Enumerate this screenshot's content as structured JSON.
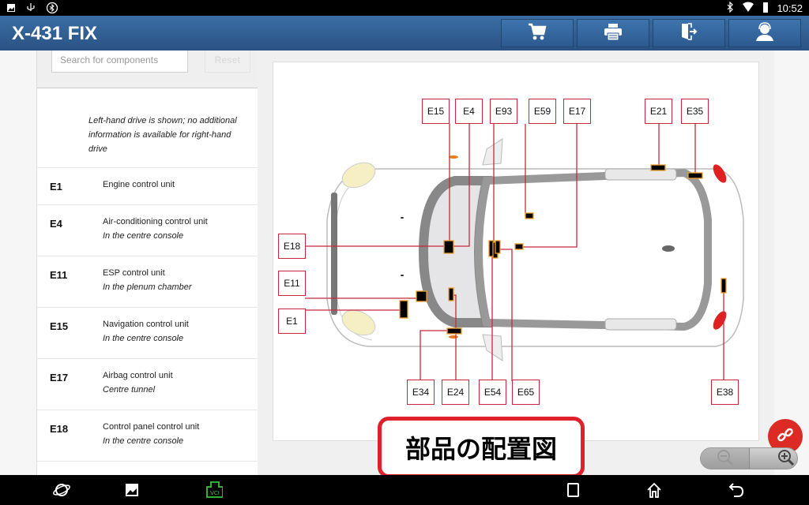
{
  "status_bar": {
    "left_icons": [
      "image-notification-icon",
      "usb-icon",
      "bluetooth-settings-icon"
    ],
    "right_icons": [
      "bluetooth-icon",
      "wifi-icon",
      "battery-icon"
    ],
    "time": "10:52"
  },
  "app_bar": {
    "title": "X-431 FIX",
    "buttons": [
      {
        "name": "cart",
        "icon": "cart-icon"
      },
      {
        "name": "print",
        "icon": "printer-icon"
      },
      {
        "name": "exit",
        "icon": "exit-icon"
      },
      {
        "name": "support",
        "icon": "headset-icon"
      }
    ]
  },
  "sidebar": {
    "search_placeholder": "Search for components",
    "reset_label": "Reset",
    "note": "Left-hand drive is shown; no additional information is available for right-hand drive",
    "items": [
      {
        "code": "E1",
        "name": "Engine control unit",
        "location": ""
      },
      {
        "code": "E4",
        "name": "Air-conditioning control unit",
        "location": "In the centre console"
      },
      {
        "code": "E11",
        "name": "ESP control unit",
        "location": "In the plenum chamber"
      },
      {
        "code": "E15",
        "name": "Navigation control unit",
        "location": "In the centre console"
      },
      {
        "code": "E17",
        "name": "Airbag control unit",
        "location": "Centre tunnel"
      },
      {
        "code": "E18",
        "name": "Control panel control unit",
        "location": "In the centre console"
      }
    ]
  },
  "diagram": {
    "callouts_top": [
      "E15",
      "E4",
      "E93",
      "E59",
      "E17",
      "E21",
      "E35"
    ],
    "callouts_left": [
      "E18",
      "E11",
      "E1"
    ],
    "callouts_bottom": [
      "E34",
      "E24",
      "E54",
      "E65",
      "E38"
    ],
    "line_color": "#c8283c",
    "marker_color": "#000000",
    "marker_border": "#f0a030"
  },
  "overlay_label": "部品の配置図",
  "fab": {
    "icon": "link-icon",
    "color": "#dc2a24"
  },
  "zoom_control": {
    "zoom_out_icon": "zoom-out-icon",
    "zoom_in_icon": "zoom-in-icon"
  },
  "nav_bar": {
    "left_icons": [
      "browser-icon",
      "gallery-icon",
      "vci-icon"
    ],
    "right_icons": [
      "recent-apps-icon",
      "home-icon",
      "back-icon"
    ],
    "vci_label": "VCI"
  }
}
